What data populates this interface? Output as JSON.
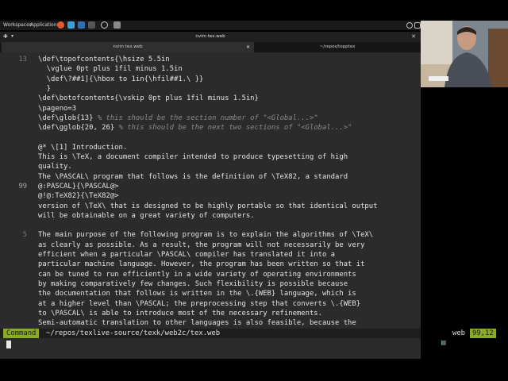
{
  "panel": {
    "workspaces": "Workspaces",
    "applications": "Applications"
  },
  "window": {
    "title": "nvim tex.web",
    "tabs": [
      {
        "label": "nvim tex.web"
      },
      {
        "label": "~/repos/topptex"
      }
    ]
  },
  "editor": {
    "lines": [
      {
        "num": "13",
        "text": "\\def\\topofcontents{\\hsize 5.5in",
        "comment": ""
      },
      {
        "num": "",
        "text": "  \\vglue 0pt plus 1fil minus 1.5in",
        "comment": ""
      },
      {
        "num": "",
        "text": "  \\def\\?##1]{\\hbox to 1in{\\hfil##1.\\ }}",
        "comment": ""
      },
      {
        "num": "",
        "text": "  }",
        "comment": ""
      },
      {
        "num": "",
        "text": "\\def\\botofcontents{\\vskip 0pt plus 1fil minus 1.5in}",
        "comment": ""
      },
      {
        "num": "",
        "text": "\\pageno=3",
        "comment": ""
      },
      {
        "num": "",
        "text": "\\def\\glob{13} ",
        "comment": "% this should be the section number of \"<Global...>\""
      },
      {
        "num": "",
        "text": "\\def\\gglob{20, 26} ",
        "comment": "% this should be the next two sections of \"<Global...>\""
      },
      {
        "num": "",
        "text": "",
        "comment": ""
      },
      {
        "num": "",
        "text": "@* \\[1] Introduction.",
        "comment": ""
      },
      {
        "num": "",
        "text": "This is \\TeX, a document compiler intended to produce typesetting of high",
        "comment": ""
      },
      {
        "num": "",
        "text": "quality.",
        "comment": ""
      },
      {
        "num": "",
        "text": "The \\PASCAL\\ program that follows is the definition of \\TeX82, a standard",
        "comment": ""
      },
      {
        "num": "99",
        "text": "@:PASCAL}{\\PASCAL@>",
        "comment": ""
      },
      {
        "num": "",
        "text": "@!@:TeX82}{\\TeX82@>",
        "comment": ""
      },
      {
        "num": "",
        "text": "version of \\TeX\\ that is designed to be highly portable so that identical output",
        "comment": ""
      },
      {
        "num": "",
        "text": "will be obtainable on a great variety of computers.",
        "comment": ""
      },
      {
        "num": "",
        "text": "",
        "comment": ""
      },
      {
        "num": "5",
        "text": "The main purpose of the following program is to explain the algorithms of \\TeX\\",
        "comment": ""
      },
      {
        "num": "",
        "text": "as clearly as possible. As a result, the program will not necessarily be very",
        "comment": ""
      },
      {
        "num": "",
        "text": "efficient when a particular \\PASCAL\\ compiler has translated it into a",
        "comment": ""
      },
      {
        "num": "",
        "text": "particular machine language. However, the program has been written so that it",
        "comment": ""
      },
      {
        "num": "",
        "text": "can be tuned to run efficiently in a wide variety of operating environments",
        "comment": ""
      },
      {
        "num": "",
        "text": "by making comparatively few changes. Such flexibility is possible because",
        "comment": ""
      },
      {
        "num": "",
        "text": "the documentation that follows is written in the \\.{WEB} language, which is",
        "comment": ""
      },
      {
        "num": "",
        "text": "at a higher level than \\PASCAL; the preprocessing step that converts \\.{WEB}",
        "comment": ""
      },
      {
        "num": "",
        "text": "to \\PASCAL\\ is able to introduce most of the necessary refinements.",
        "comment": ""
      },
      {
        "num": "",
        "text": "Semi-automatic translation to other languages is also feasible, because the",
        "comment": ""
      }
    ]
  },
  "statusline": {
    "mode": "Command",
    "filepath": "~/repos/texlive-source/texk/web2c/tex.web",
    "filetype": "web",
    "position": "99,12"
  }
}
